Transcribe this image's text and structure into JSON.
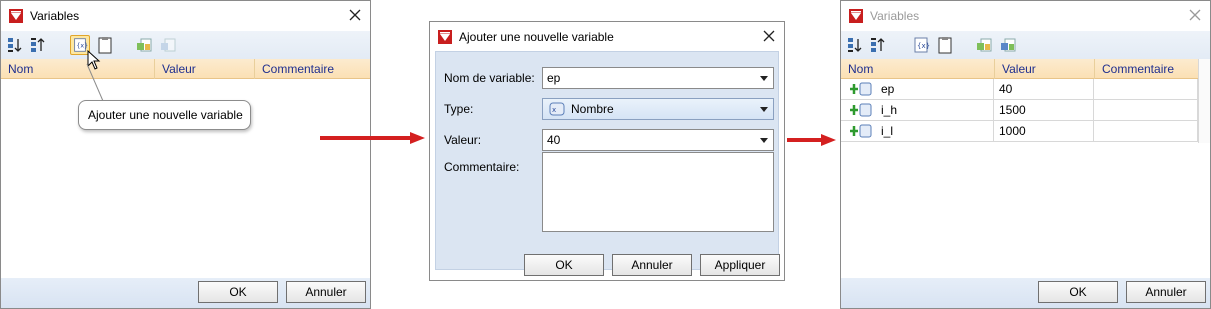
{
  "left_dialog": {
    "title": "Variables",
    "columns": [
      "Nom",
      "Valeur",
      "Commentaire"
    ],
    "tooltip": "Ajouter une nouvelle variable",
    "ok_label": "OK",
    "cancel_label": "Annuler",
    "toolbar_icons": [
      "sort-ascending-icon",
      "sort-descending-icon",
      "add-variable-icon",
      "clipboard-icon",
      "import-variables-icon",
      "export-variables-icon"
    ]
  },
  "middle_dialog": {
    "title": "Ajouter une nouvelle variable",
    "name_label": "Nom de variable:",
    "name_value": "ep",
    "type_label": "Type:",
    "type_value": "Nombre",
    "value_label": "Valeur:",
    "value_value": "40",
    "comment_label": "Commentaire:",
    "comment_value": "",
    "ok_label": "OK",
    "cancel_label": "Annuler",
    "apply_label": "Appliquer"
  },
  "right_dialog": {
    "title": "Variables",
    "columns": [
      "Nom",
      "Valeur",
      "Commentaire"
    ],
    "rows": [
      {
        "name": "ep",
        "value": "40",
        "comment": ""
      },
      {
        "name": "i_h",
        "value": "1500",
        "comment": ""
      },
      {
        "name": "i_l",
        "value": "1000",
        "comment": ""
      }
    ],
    "ok_label": "OK",
    "cancel_label": "Annuler"
  },
  "colors": {
    "header_gradient": "#fbe0b4",
    "header_text": "#1f2f8f",
    "arrow": "#d42020",
    "form_bg": "#dbe5f2"
  }
}
